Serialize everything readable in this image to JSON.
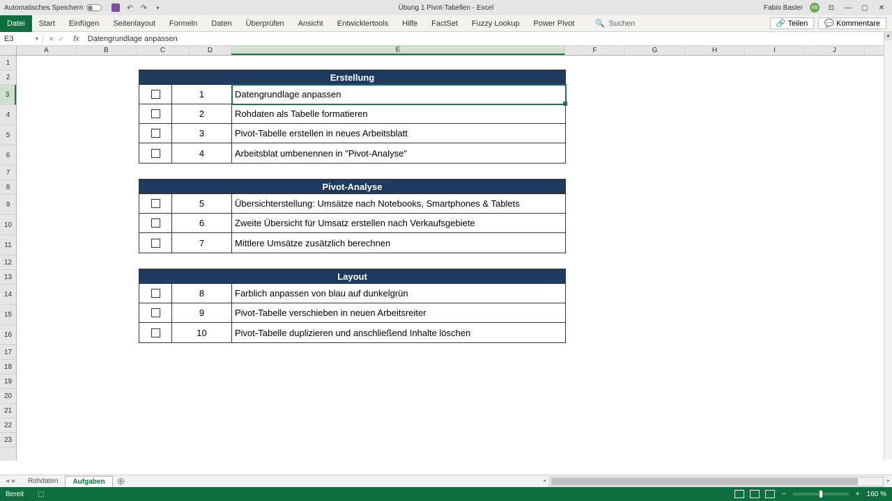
{
  "titlebar": {
    "autosave_label": "Automatisches Speichern",
    "doc_title": "Übung 1 Pivot-Tabellen - Excel",
    "user_name": "Fabio Basler",
    "user_initials": "FB"
  },
  "ribbon": {
    "file": "Datei",
    "tabs": [
      "Start",
      "Einfügen",
      "Seitenlayout",
      "Formeln",
      "Daten",
      "Überprüfen",
      "Ansicht",
      "Entwicklertools",
      "Hilfe",
      "FactSet",
      "Fuzzy Lookup",
      "Power Pivot"
    ],
    "search": "Suchen",
    "share": "Teilen",
    "comments": "Kommentare"
  },
  "namebox": {
    "ref": "E3"
  },
  "formula": {
    "text": "Datengrundlage anpassen"
  },
  "columns": [
    "A",
    "B",
    "C",
    "D",
    "E",
    "F",
    "G",
    "H",
    "I",
    "J"
  ],
  "row_numbers": [
    1,
    2,
    3,
    4,
    5,
    6,
    7,
    8,
    9,
    10,
    11,
    12,
    13,
    14,
    15,
    16,
    17,
    18,
    19,
    20,
    21,
    22,
    23
  ],
  "sections": [
    {
      "title": "Erstellung",
      "rows": [
        {
          "num": "1",
          "text": "Datengrundlage anpassen"
        },
        {
          "num": "2",
          "text": "Rohdaten als Tabelle formatieren"
        },
        {
          "num": "3",
          "text": "Pivot-Tabelle erstellen in neues Arbeitsblatt"
        },
        {
          "num": "4",
          "text": "Arbeitsblat umbenennen in \"Pivot-Analyse\""
        }
      ]
    },
    {
      "title": "Pivot-Analyse",
      "rows": [
        {
          "num": "5",
          "text": "Übersichterstellung: Umsätze nach Notebooks, Smartphones & Tablets"
        },
        {
          "num": "6",
          "text": "Zweite Übersicht für Umsatz erstellen nach Verkaufsgebiete"
        },
        {
          "num": "7",
          "text": "Mittlere Umsätze zusätzlich berechnen"
        }
      ]
    },
    {
      "title": "Layout",
      "rows": [
        {
          "num": "8",
          "text": "Farblich anpassen von blau auf dunkelgrün"
        },
        {
          "num": "9",
          "text": "Pivot-Tabelle verschieben in neuen Arbeitsreiter"
        },
        {
          "num": "10",
          "text": "Pivot-Tabelle duplizieren und anschließend Inhalte löschen"
        }
      ]
    }
  ],
  "sheets": {
    "tabs": [
      "Rohdaten",
      "Aufgaben"
    ],
    "active": "Aufgaben"
  },
  "status": {
    "ready": "Bereit",
    "zoom": "160 %"
  }
}
